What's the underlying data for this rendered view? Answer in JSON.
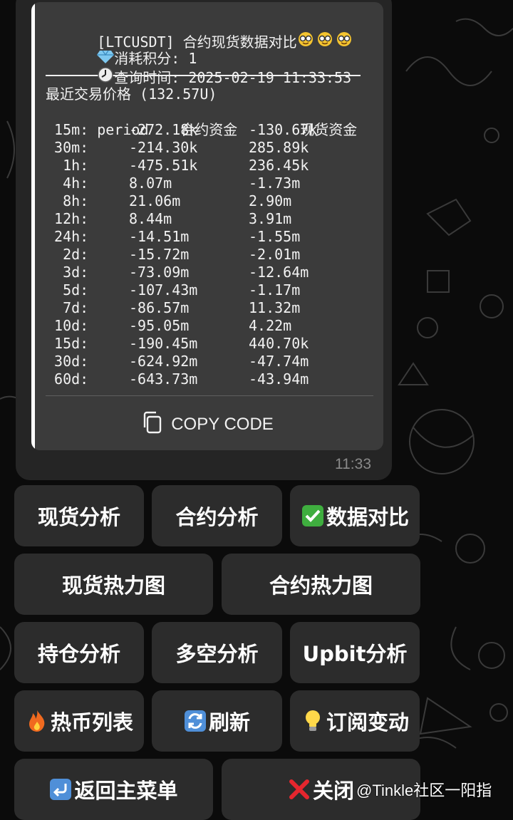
{
  "message": {
    "title": "[LTCUSDT] 合约现货数据对比",
    "points_line": "消耗积分: 1",
    "time_line": "查询时间: 2025-02-19 11:33:53",
    "price_line": "最近交易价格 (132.57U)",
    "columns": [
      "period",
      "合约资金",
      "现货资金"
    ],
    "rows": [
      {
        "period": " 15m:",
        "futures": "-272.18k",
        "spot": "-130.67k"
      },
      {
        "period": " 30m:",
        "futures": "-214.30k",
        "spot": "285.89k"
      },
      {
        "period": "  1h:",
        "futures": "-475.51k",
        "spot": "236.45k"
      },
      {
        "period": "  4h:",
        "futures": "8.07m",
        "spot": "-1.73m"
      },
      {
        "period": "  8h:",
        "futures": "21.06m",
        "spot": "2.90m"
      },
      {
        "period": " 12h:",
        "futures": "8.44m",
        "spot": "3.91m"
      },
      {
        "period": " 24h:",
        "futures": "-14.51m",
        "spot": "-1.55m"
      },
      {
        "period": "  2d:",
        "futures": "-15.72m",
        "spot": "-2.01m"
      },
      {
        "period": "  3d:",
        "futures": "-73.09m",
        "spot": "-12.64m"
      },
      {
        "period": "  5d:",
        "futures": "-107.43m",
        "spot": "-1.17m"
      },
      {
        "period": "  7d:",
        "futures": "-86.57m",
        "spot": "11.32m"
      },
      {
        "period": " 10d:",
        "futures": "-95.05m",
        "spot": "4.22m"
      },
      {
        "period": " 15d:",
        "futures": "-190.45m",
        "spot": "440.70k"
      },
      {
        "period": " 30d:",
        "futures": "-624.92m",
        "spot": "-47.74m"
      },
      {
        "period": " 60d:",
        "futures": "-643.73m",
        "spot": "-43.94m"
      }
    ],
    "copy_label": "COPY CODE",
    "timestamp": "11:33"
  },
  "keyboard": {
    "spot_analysis": "现货分析",
    "futures_analysis": "合约分析",
    "data_compare": "数据对比",
    "spot_heatmap": "现货热力图",
    "futures_heatmap": "合约热力图",
    "position_analysis": "持仓分析",
    "long_short_analysis": "多空分析",
    "upbit_analysis": "Upbit分析",
    "hot_coins": "热币列表",
    "refresh": "刷新",
    "subscribe": "订阅变动",
    "main_menu": "返回主菜单",
    "close": "关闭"
  },
  "watermark": "@Tinkle社区一阳指",
  "icons": {
    "title": "nerd-face-emoji",
    "points": "gem-icon",
    "time": "clock-icon",
    "copy": "copy-icon",
    "compare": "check-mark-button-emoji",
    "hot": "fire-emoji",
    "refresh": "refresh-icon",
    "subscribe": "light-bulb-emoji",
    "menu": "return-arrow-icon",
    "close": "cross-mark-emoji"
  },
  "colors": {
    "background": "#0b0b0b",
    "bubble": "#252525",
    "code_block": "#3b3b3b",
    "button": "#2c2c2c",
    "timestamp": "#8a8a8a"
  }
}
